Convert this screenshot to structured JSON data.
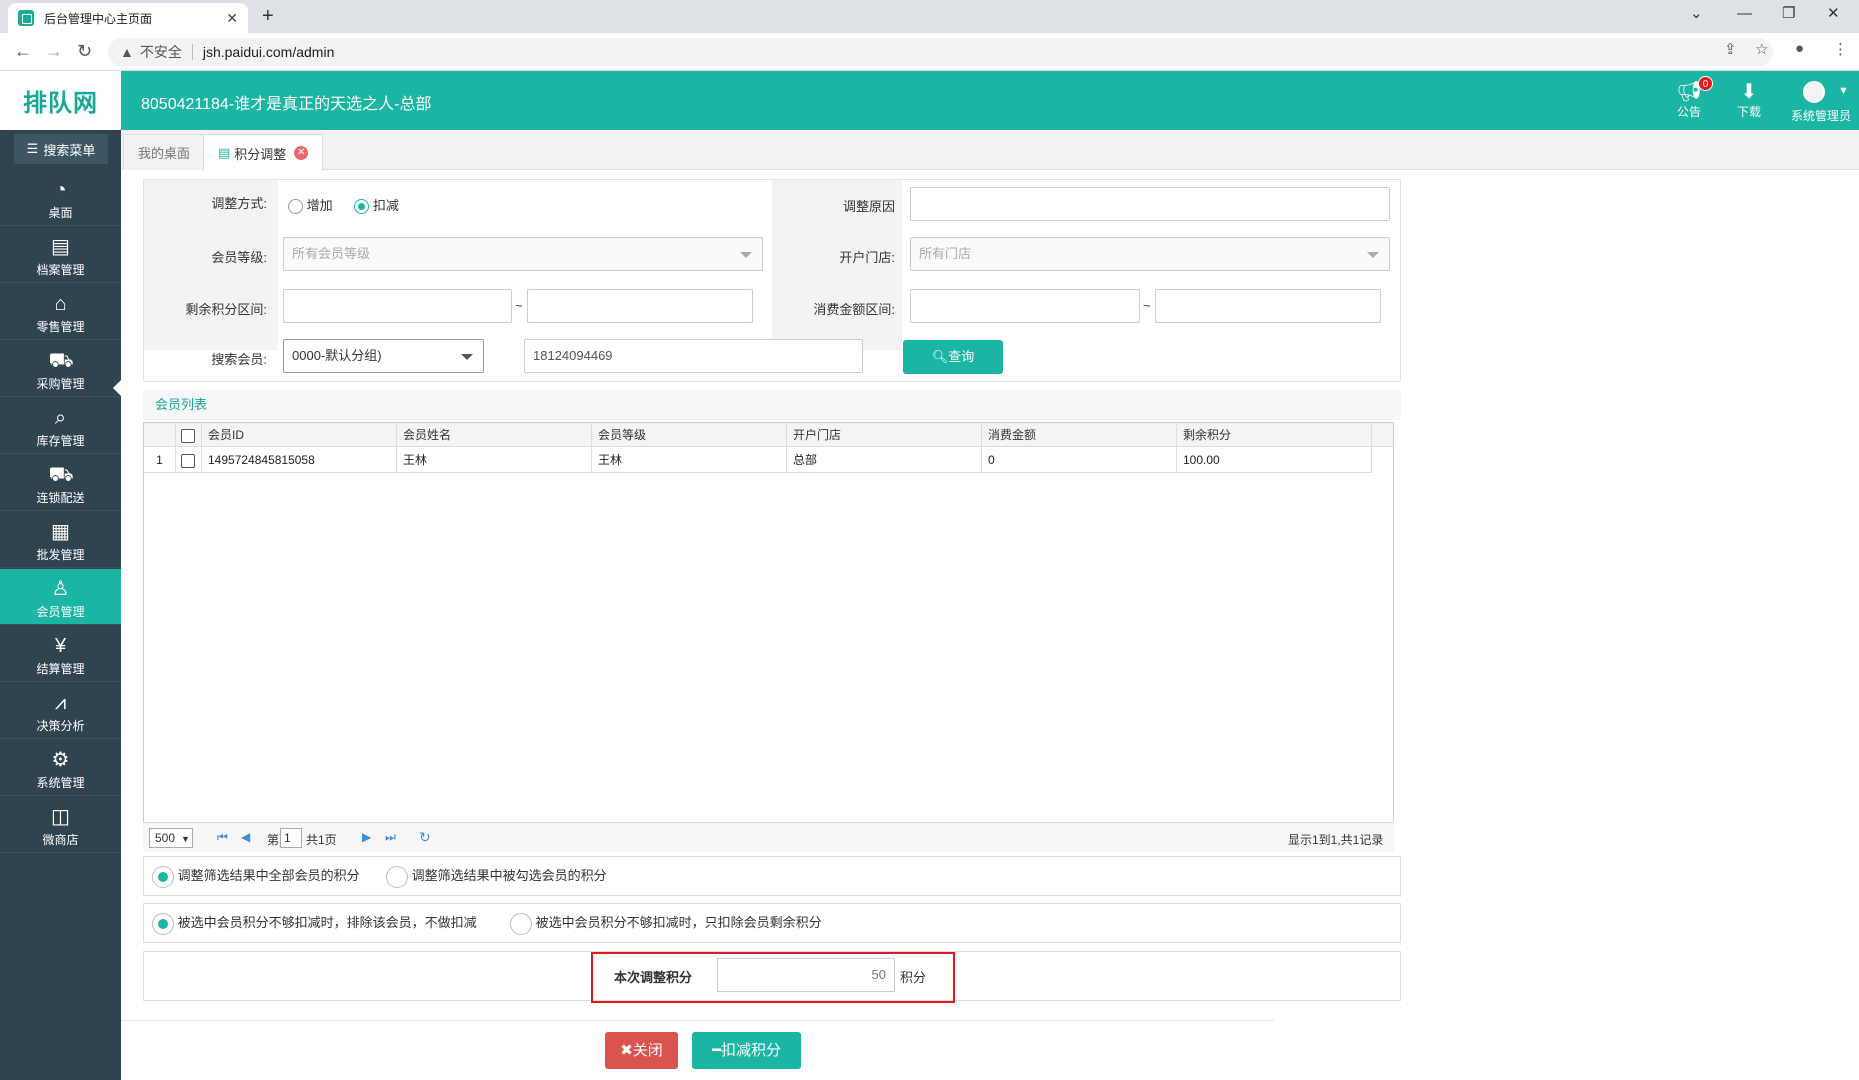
{
  "browser": {
    "tab_title": "后台管理中心主页面",
    "insecure": "不安全",
    "url": "jsh.paidui.com/admin"
  },
  "header": {
    "logo": "排队网",
    "shop_name": "8050421184-谁才是真正的天选之人-总部",
    "notice_label": "公告",
    "notice_count": "0",
    "download_label": "下载",
    "user_label": "系统管理员"
  },
  "sidebar": {
    "search_label": "搜索菜单",
    "items": [
      {
        "label": "桌面",
        "icon": "dashboard-icon"
      },
      {
        "label": "档案管理",
        "icon": "archive-icon"
      },
      {
        "label": "零售管理",
        "icon": "store-icon"
      },
      {
        "label": "采购管理",
        "icon": "cart-icon"
      },
      {
        "label": "库存管理",
        "icon": "inventory-icon"
      },
      {
        "label": "连锁配送",
        "icon": "truck-icon"
      },
      {
        "label": "批发管理",
        "icon": "wholesale-icon"
      },
      {
        "label": "会员管理",
        "icon": "member-icon"
      },
      {
        "label": "结算管理",
        "icon": "settlement-icon"
      },
      {
        "label": "决策分析",
        "icon": "chart-icon"
      },
      {
        "label": "系统管理",
        "icon": "gear-icon"
      },
      {
        "label": "微商店",
        "icon": "shop-bag-icon"
      }
    ],
    "active": "会员管理"
  },
  "tabs": [
    {
      "label": "我的桌面"
    },
    {
      "label": "积分调整"
    }
  ],
  "form": {
    "adjust_mode_label": "调整方式:",
    "opt_add": "增加",
    "opt_deduct": "扣减",
    "selected": "扣减",
    "reason_label": "调整原因",
    "reason_value": "",
    "level_label": "会员等级:",
    "level_value": "所有会员等级",
    "store_label": "开户门店:",
    "store_value": "所有门店",
    "points_range_label": "剩余积分区间:",
    "range_sep": "~",
    "amount_range_label": "消费金额区间:",
    "search_member_label": "搜索会员:",
    "group_value": "0000-默认分组)",
    "search_value": "18124094469",
    "query_label": "查询"
  },
  "list": {
    "title": "会员列表",
    "columns": [
      "会员ID",
      "会员姓名",
      "会员等级",
      "开户门店",
      "消费金额",
      "剩余积分"
    ],
    "rows": [
      {
        "no": "1",
        "id": "1495724845815058",
        "name": "王林",
        "level": "王林",
        "store": "总部",
        "amount": "0",
        "points": "100.00"
      }
    ],
    "pager": {
      "page_size": "500",
      "page_prefix": "第",
      "page": "1",
      "total_pages": "共1页",
      "summary": "显示1到1,共1记录"
    }
  },
  "options": {
    "scope_all": "调整筛选结果中全部会员的积分",
    "scope_checked": "调整筛选结果中被勾选会员的积分",
    "insufficient_skip": "被选中会员积分不够扣减时，排除该会员，不做扣减",
    "insufficient_partial": "被选中会员积分不够扣减时，只扣除会员剩余积分"
  },
  "adjust": {
    "label": "本次调整积分",
    "value": "50",
    "unit": "积分"
  },
  "buttons": {
    "close": "关闭",
    "deduct": "扣减积分"
  },
  "colors": {
    "accent": "#1ab5a3",
    "sidebar": "#304450",
    "danger": "#d9534f"
  }
}
